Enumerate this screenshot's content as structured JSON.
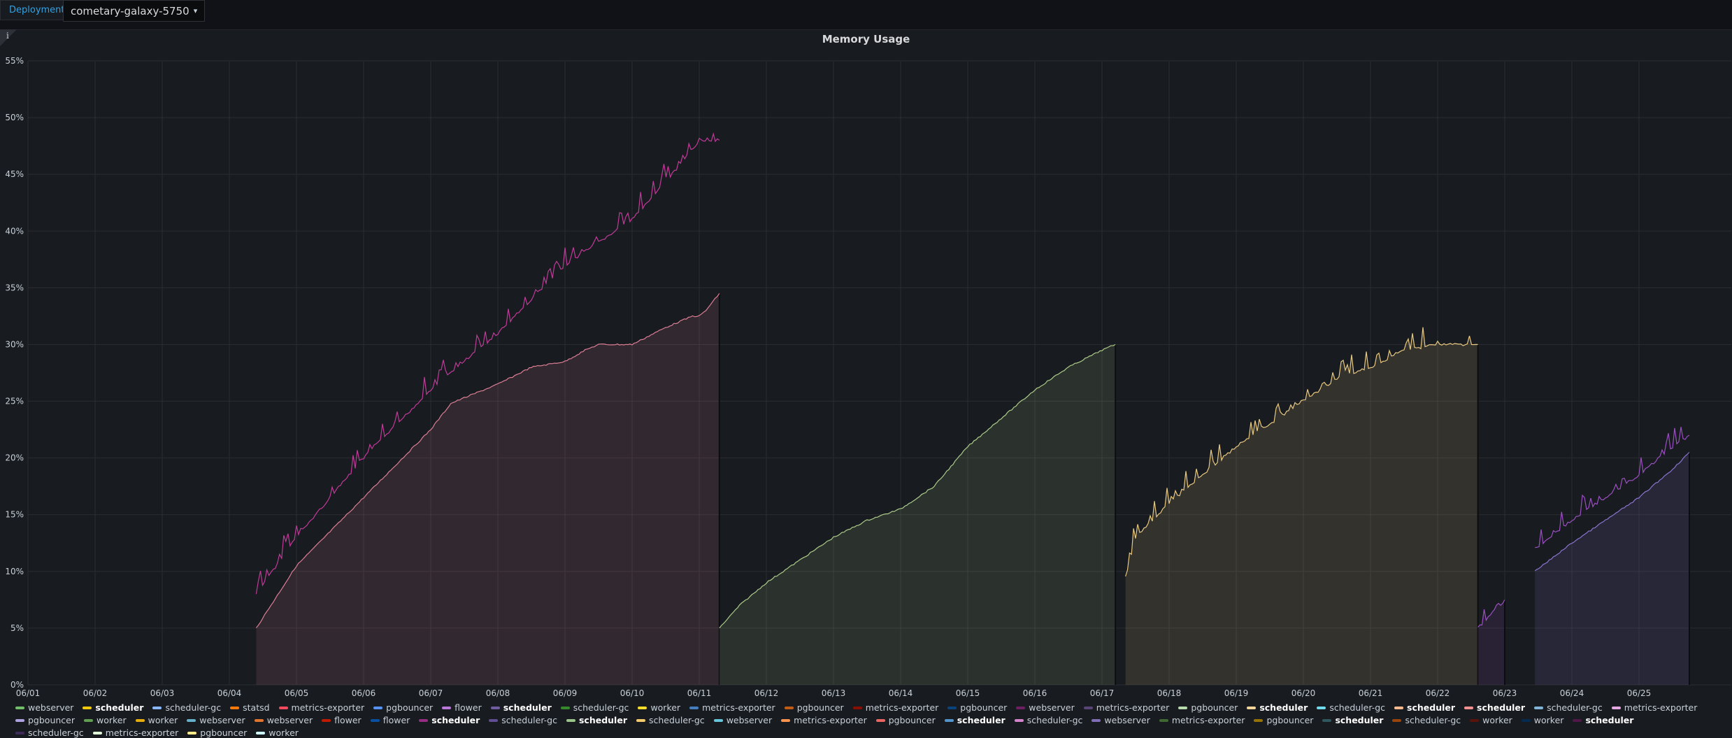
{
  "topbar": {
    "variable_label": "Deployment",
    "variable_value": "cometary-galaxy-5750"
  },
  "panel": {
    "title": "Memory Usage",
    "info_icon": "info-icon"
  },
  "chart_data": {
    "type": "line",
    "title": "Memory Usage",
    "xlabel": "",
    "ylabel": "",
    "x_ticks": [
      "06/01",
      "06/02",
      "06/03",
      "06/04",
      "06/05",
      "06/06",
      "06/07",
      "06/08",
      "06/09",
      "06/10",
      "06/11",
      "06/12",
      "06/13",
      "06/14",
      "06/15",
      "06/16",
      "06/17",
      "06/18",
      "06/19",
      "06/20",
      "06/21",
      "06/22",
      "06/23",
      "06/24",
      "06/25"
    ],
    "y_ticks": [
      "0%",
      "5%",
      "10%",
      "15%",
      "20%",
      "25%",
      "30%",
      "35%",
      "40%",
      "45%",
      "50%",
      "55%"
    ],
    "xlim": [
      "06/01",
      "06/26"
    ],
    "ylim": [
      0,
      55
    ],
    "grid": true,
    "legend": "bottom",
    "series": [
      {
        "name": "flower",
        "color": "#c93ca0",
        "fill": false,
        "x": [
          4.4,
          5.0,
          6.0,
          7.0,
          8.0,
          9.0,
          10.0,
          10.6,
          11.0,
          11.3
        ],
        "y": [
          8,
          13,
          20,
          26,
          31,
          37,
          41,
          45,
          48,
          48
        ],
        "spiky": true
      },
      {
        "name": "scheduler",
        "color": "#e6839b",
        "fill": true,
        "x": [
          4.4,
          5.0,
          6.0,
          7.0,
          7.3,
          7.5,
          8.0,
          8.5,
          9.0,
          9.3,
          9.5,
          10.0,
          10.5,
          10.9,
          11.0,
          11.1,
          11.3
        ],
        "y": [
          5,
          10.5,
          16.5,
          22.5,
          24.8,
          25.3,
          26.5,
          28,
          28.5,
          29.5,
          30,
          30,
          31.5,
          32.5,
          32.5,
          33,
          34.5
        ],
        "spiky": false
      },
      {
        "name": "pgbouncer",
        "color": "#b4d48e",
        "fill": true,
        "x": [
          11.3,
          11.6,
          12.0,
          12.5,
          13.0,
          13.5,
          14.0,
          14.5,
          15.0,
          15.5,
          16.0,
          16.5,
          17.0,
          17.2
        ],
        "y": [
          5,
          7,
          9,
          11,
          13,
          14.5,
          15.5,
          17.5,
          21,
          23.5,
          26,
          28,
          29.5,
          30
        ],
        "spiky": false
      },
      {
        "name": "scheduler",
        "color": "#f2d186",
        "fill": true,
        "x": [
          17.35,
          17.5,
          18.0,
          18.5,
          19.0,
          19.5,
          20.0,
          20.5,
          21.0,
          21.5,
          22.0,
          22.6
        ],
        "y": [
          9.5,
          13,
          16,
          18.5,
          21,
          23,
          25,
          27,
          28,
          29.5,
          30,
          30
        ],
        "spiky": true
      },
      {
        "name": "webserver",
        "color": "#a352cc",
        "fill": true,
        "x": [
          22.6,
          23.0
        ],
        "y": [
          5,
          7.5
        ],
        "spiky": true
      },
      {
        "name": "scheduler-gc",
        "color": "#8f78d9",
        "fill": true,
        "x": [
          23.45,
          24.0,
          24.5,
          25.0,
          25.5,
          25.75
        ],
        "y": [
          10,
          12.5,
          14.5,
          16.5,
          19,
          20.5
        ],
        "spiky": false
      },
      {
        "name": "webserver",
        "color": "#a352cc",
        "fill": false,
        "x": [
          23.45,
          24.0,
          24.5,
          25.0,
          25.5,
          25.75
        ],
        "y": [
          12,
          14.5,
          16.5,
          18.5,
          21,
          22
        ],
        "spiky": true
      }
    ]
  },
  "legend": [
    {
      "label": "webserver",
      "color": "#73bf69",
      "bold": false
    },
    {
      "label": "scheduler",
      "color": "#f2cc0c",
      "bold": true
    },
    {
      "label": "scheduler-gc",
      "color": "#8ab8ff",
      "bold": false
    },
    {
      "label": "statsd",
      "color": "#ff780a",
      "bold": false
    },
    {
      "label": "metrics-exporter",
      "color": "#f2495c",
      "bold": false
    },
    {
      "label": "pgbouncer",
      "color": "#5794f2",
      "bold": false
    },
    {
      "label": "flower",
      "color": "#b877d9",
      "bold": false
    },
    {
      "label": "scheduler",
      "color": "#705da0",
      "bold": true
    },
    {
      "label": "scheduler-gc",
      "color": "#37872d",
      "bold": false
    },
    {
      "label": "worker",
      "color": "#fade2a",
      "bold": false
    },
    {
      "label": "metrics-exporter",
      "color": "#447ebc",
      "bold": false
    },
    {
      "label": "pgbouncer",
      "color": "#c15c17",
      "bold": false
    },
    {
      "label": "metrics-exporter",
      "color": "#890f02",
      "bold": false
    },
    {
      "label": "pgbouncer",
      "color": "#0a437c",
      "bold": false
    },
    {
      "label": "webserver",
      "color": "#6d1f62",
      "bold": false
    },
    {
      "label": "metrics-exporter",
      "color": "#584477",
      "bold": false
    },
    {
      "label": "pgbouncer",
      "color": "#b7dbab",
      "bold": false
    },
    {
      "label": "scheduler",
      "color": "#f4d598",
      "bold": true
    },
    {
      "label": "scheduler-gc",
      "color": "#70dbed",
      "bold": false
    },
    {
      "label": "scheduler",
      "color": "#f9ba8f",
      "bold": true
    },
    {
      "label": "scheduler",
      "color": "#f29191",
      "bold": true
    },
    {
      "label": "scheduler-gc",
      "color": "#82b5d8",
      "bold": false
    },
    {
      "label": "metrics-exporter",
      "color": "#e5a8e2",
      "bold": false
    },
    {
      "label": "pgbouncer",
      "color": "#aea2e0",
      "bold": false
    },
    {
      "label": "worker",
      "color": "#629e51",
      "bold": false
    },
    {
      "label": "worker",
      "color": "#e5ac0e",
      "bold": false
    },
    {
      "label": "webserver",
      "color": "#64b0c8",
      "bold": false
    },
    {
      "label": "webserver",
      "color": "#e0752d",
      "bold": false
    },
    {
      "label": "flower",
      "color": "#bf1b00",
      "bold": false
    },
    {
      "label": "flower",
      "color": "#0a50a1",
      "bold": false
    },
    {
      "label": "scheduler",
      "color": "#962d82",
      "bold": true
    },
    {
      "label": "scheduler-gc",
      "color": "#614d93",
      "bold": false
    },
    {
      "label": "scheduler",
      "color": "#9ac48a",
      "bold": true
    },
    {
      "label": "scheduler-gc",
      "color": "#f2c96d",
      "bold": false
    },
    {
      "label": "webserver",
      "color": "#65c5db",
      "bold": false
    },
    {
      "label": "metrics-exporter",
      "color": "#f9934e",
      "bold": false
    },
    {
      "label": "pgbouncer",
      "color": "#ea6460",
      "bold": false
    },
    {
      "label": "scheduler",
      "color": "#5195ce",
      "bold": true
    },
    {
      "label": "scheduler-gc",
      "color": "#d683ce",
      "bold": false
    },
    {
      "label": "webserver",
      "color": "#806eb7",
      "bold": false
    },
    {
      "label": "metrics-exporter",
      "color": "#3f6833",
      "bold": false
    },
    {
      "label": "pgbouncer",
      "color": "#967302",
      "bold": false
    },
    {
      "label": "scheduler",
      "color": "#2f575e",
      "bold": true
    },
    {
      "label": "scheduler-gc",
      "color": "#99440a",
      "bold": false
    },
    {
      "label": "worker",
      "color": "#58140c",
      "bold": false
    },
    {
      "label": "worker",
      "color": "#052b51",
      "bold": false
    },
    {
      "label": "scheduler",
      "color": "#511749",
      "bold": true
    },
    {
      "label": "scheduler-gc",
      "color": "#3f2b5b",
      "bold": false
    },
    {
      "label": "metrics-exporter",
      "color": "#e0f9d7",
      "bold": false
    },
    {
      "label": "pgbouncer",
      "color": "#fcea8b",
      "bold": false
    },
    {
      "label": "worker",
      "color": "#cffaff",
      "bold": false
    }
  ]
}
